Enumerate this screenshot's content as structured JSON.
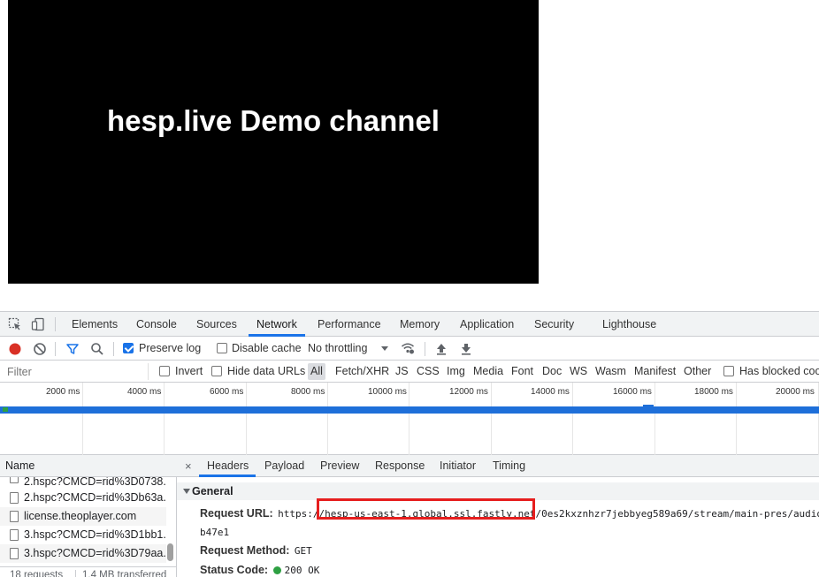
{
  "player": {
    "title": "hesp.live Demo channel"
  },
  "devtools": {
    "tabs": [
      "Elements",
      "Console",
      "Sources",
      "Network",
      "Performance",
      "Memory",
      "Application",
      "Security",
      "Lighthouse"
    ],
    "active_tab": "Network",
    "toolbar": {
      "preserve_log": "Preserve log",
      "disable_cache": "Disable cache",
      "throttling": "No throttling"
    },
    "filter": {
      "placeholder": "Filter",
      "invert": "Invert",
      "hide_data_urls": "Hide data URLs",
      "types": [
        "All",
        "Fetch/XHR",
        "JS",
        "CSS",
        "Img",
        "Media",
        "Font",
        "Doc",
        "WS",
        "Wasm",
        "Manifest",
        "Other"
      ],
      "has_blocked": "Has blocked coo"
    },
    "timeline": {
      "ticks": [
        "2000 ms",
        "4000 ms",
        "6000 ms",
        "8000 ms",
        "10000 ms",
        "12000 ms",
        "14000 ms",
        "16000 ms",
        "18000 ms",
        "20000 ms"
      ]
    },
    "requests": {
      "header": "Name",
      "items": [
        "2.hspc?CMCD=rid%3D0738.",
        "2.hspc?CMCD=rid%3Db63a.",
        "license.theoplayer.com",
        "3.hspc?CMCD=rid%3D1bb1.",
        "3.hspc?CMCD=rid%3D79aa."
      ],
      "summary_requests": "18 requests",
      "summary_transferred": "1.4 MB transferred"
    },
    "detail": {
      "close": "×",
      "tabs": [
        "Headers",
        "Payload",
        "Preview",
        "Response",
        "Initiator",
        "Timing"
      ],
      "section": "General",
      "request_url_label": "Request URL:",
      "request_url_prefix": "https://",
      "request_url_host": "hesp-us-east-1.global.ssl.fastly.net",
      "request_url_rest": "/0es2kxznhzr7jebbyeg589a69/stream/main-pres/audio",
      "request_url_wrap": "b47e1",
      "request_method_label": "Request Method:",
      "request_method": "GET",
      "status_code_label": "Status Code:",
      "status_code": "200 OK"
    }
  }
}
